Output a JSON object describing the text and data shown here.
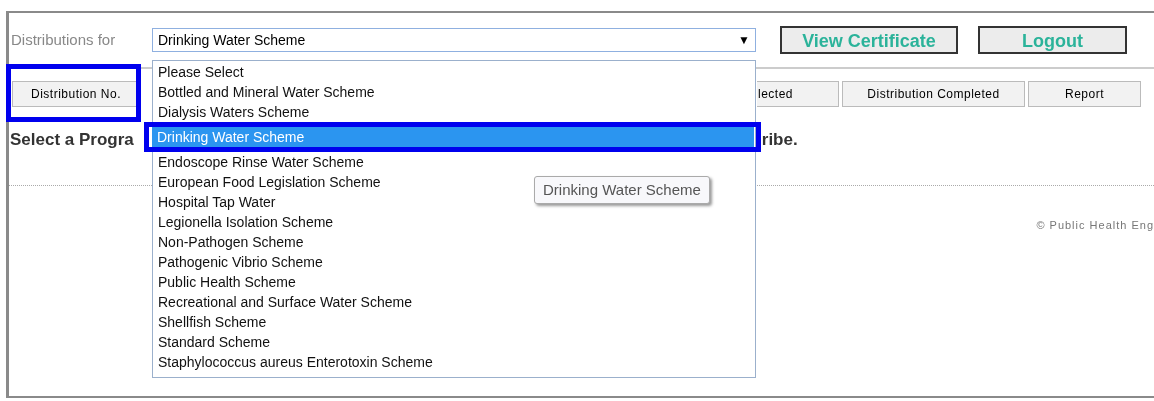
{
  "toolbar": {
    "label": "Distributions for",
    "select": {
      "value": "Drinking Water Scheme",
      "arrow": "▼"
    },
    "buttons": [
      "View Certificate",
      "Logout"
    ]
  },
  "table_header": [
    {
      "label": "Distribution No."
    },
    {
      "label": "lected"
    },
    {
      "label": "Distribution Completed"
    },
    {
      "label": "Report"
    }
  ],
  "message": {
    "left": "Select a Progra",
    "right": "ribe."
  },
  "footer": "© Public Health Eng",
  "dropdown": {
    "options": [
      {
        "label": "Please Select",
        "selected": false
      },
      {
        "label": "Bottled and Mineral Water Scheme",
        "selected": false
      },
      {
        "label": "Dialysis Waters Scheme",
        "selected": false
      },
      {
        "label": "Drinking Water Scheme",
        "selected": true
      },
      {
        "label": "Endoscope Rinse Water Scheme",
        "selected": false
      },
      {
        "label": "European Food Legislation Scheme",
        "selected": false
      },
      {
        "label": "Hospital Tap Water",
        "selected": false
      },
      {
        "label": "Legionella Isolation Scheme",
        "selected": false
      },
      {
        "label": "Non-Pathogen Scheme",
        "selected": false
      },
      {
        "label": "Pathogenic Vibrio Scheme",
        "selected": false
      },
      {
        "label": "Public Health Scheme",
        "selected": false
      },
      {
        "label": "Recreational and Surface Water Scheme",
        "selected": false
      },
      {
        "label": "Shellfish Scheme",
        "selected": false
      },
      {
        "label": "Standard Scheme",
        "selected": false
      },
      {
        "label": "Staphylococcus aureus Enterotoxin Scheme",
        "selected": false
      }
    ]
  },
  "tooltip": "Drinking Water Scheme"
}
